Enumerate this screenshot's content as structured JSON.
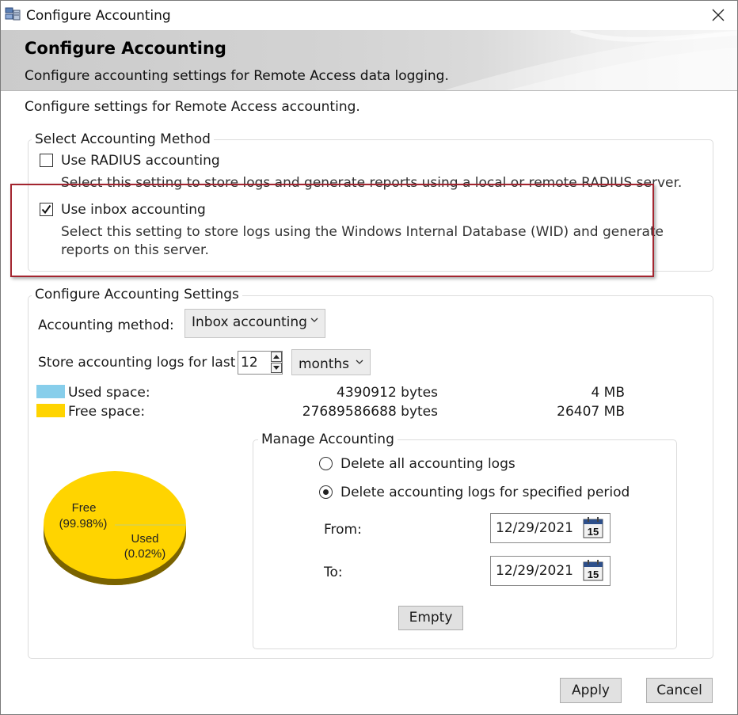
{
  "window": {
    "title": "Configure Accounting"
  },
  "banner": {
    "heading": "Configure Accounting",
    "subtitle": "Configure accounting settings for Remote Access data logging."
  },
  "intro": "Configure settings for Remote Access accounting.",
  "method_group": {
    "legend": "Select Accounting Method",
    "radius": {
      "label": "Use RADIUS accounting",
      "checked": false,
      "description": "Select this setting to store logs and generate reports using a local or remote RADIUS server."
    },
    "inbox": {
      "label": "Use inbox accounting",
      "checked": true,
      "description_line1": "Select this setting to store logs using the Windows Internal Database (WID) and generate",
      "description_line2": "reports on this server."
    }
  },
  "settings_group": {
    "legend": "Configure Accounting Settings",
    "method_label": "Accounting method:",
    "method_value": "Inbox accounting",
    "store_label": "Store accounting logs for last",
    "store_value": "12",
    "period_value": "months",
    "used": {
      "label": "Used space:",
      "bytes": "4390912 bytes",
      "mb": "4 MB",
      "color": "#87ceeb"
    },
    "free": {
      "label": "Free space:",
      "bytes": "27689586688 bytes",
      "mb": "26407 MB",
      "color": "#ffd400"
    },
    "pie": {
      "free_label": "Free",
      "free_pct_label": "(99.98%)",
      "used_label": "Used",
      "used_pct_label": "(0.02%)",
      "free_percent": 99.98,
      "used_percent": 0.02
    }
  },
  "manage_group": {
    "legend": "Manage Accounting",
    "delete_all_label": "Delete all accounting logs",
    "delete_all_selected": false,
    "delete_period_label": "Delete accounting logs for specified period",
    "delete_period_selected": true,
    "from_label": "From:",
    "from_value": "12/29/2021",
    "to_label": "To:",
    "to_value": "12/29/2021",
    "calendar_day": "15",
    "empty_button": "Empty"
  },
  "footer": {
    "apply": "Apply",
    "cancel": "Cancel"
  },
  "icons": {
    "app": "network-server-icon",
    "close": "close-icon",
    "checkmark": "checkmark-icon",
    "chevron": "chevron-down-icon",
    "calendar": "calendar-icon"
  },
  "colors": {
    "highlight_border": "#a3252f"
  }
}
